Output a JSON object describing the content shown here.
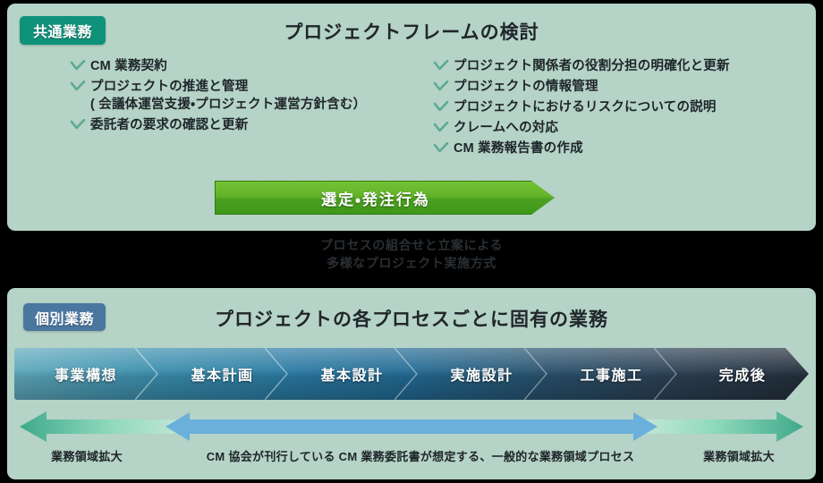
{
  "colors": {
    "page_background": "#000000",
    "panel_background": "#b5d3c6",
    "badge_common": "#0e9279",
    "badge_individual": "#4a77a0",
    "green_arrow": "#55ad24",
    "check_mark": "#5caa93",
    "scope_arrow_green": "#3fa98a",
    "scope_arrow_blue": "#6bb0dc",
    "text_dark": "#1e2429",
    "text_white": "#ffffff"
  },
  "common_section": {
    "badge_label": "共通業務",
    "title": "プロジェクトフレームの検討",
    "bullets_left": [
      "CM 業務契約",
      "プロジェクトの推進と管理\n( 会議体運営支援・プロジェクト運営方針含む）",
      "委託者の要求の確認と更新"
    ],
    "bullets_right": [
      "プロジェクト関係者の役割分担の明確化と更新",
      "プロジェクトの情報管理",
      "プロジェクトにおけるリスクについての説明",
      "クレームへの対応",
      "CM 業務報告書の作成"
    ],
    "action_arrow_label": "選定・発注行為"
  },
  "middle_note": "プロセスの組合せと立案による\n多様なプロジェクト実施方式",
  "individual_section": {
    "badge_label": "個別業務",
    "title": "プロジェクトの各プロセスごとに固有の業務",
    "stages": [
      {
        "label": "事業構想",
        "width": 160
      },
      {
        "label": "基本計画",
        "width": 145
      },
      {
        "label": "基本設計",
        "width": 145
      },
      {
        "label": "実施設計",
        "width": 145
      },
      {
        "label": "工事施工",
        "width": 145
      },
      {
        "label": "完成後",
        "width": 148
      }
    ]
  },
  "scope": {
    "caption_left": "業務領域拡大",
    "caption_center": "CM 協会が刊行している CM 業務委託書が想定する、一般的な業務領域プロセス",
    "caption_right": "業務領域拡大"
  }
}
